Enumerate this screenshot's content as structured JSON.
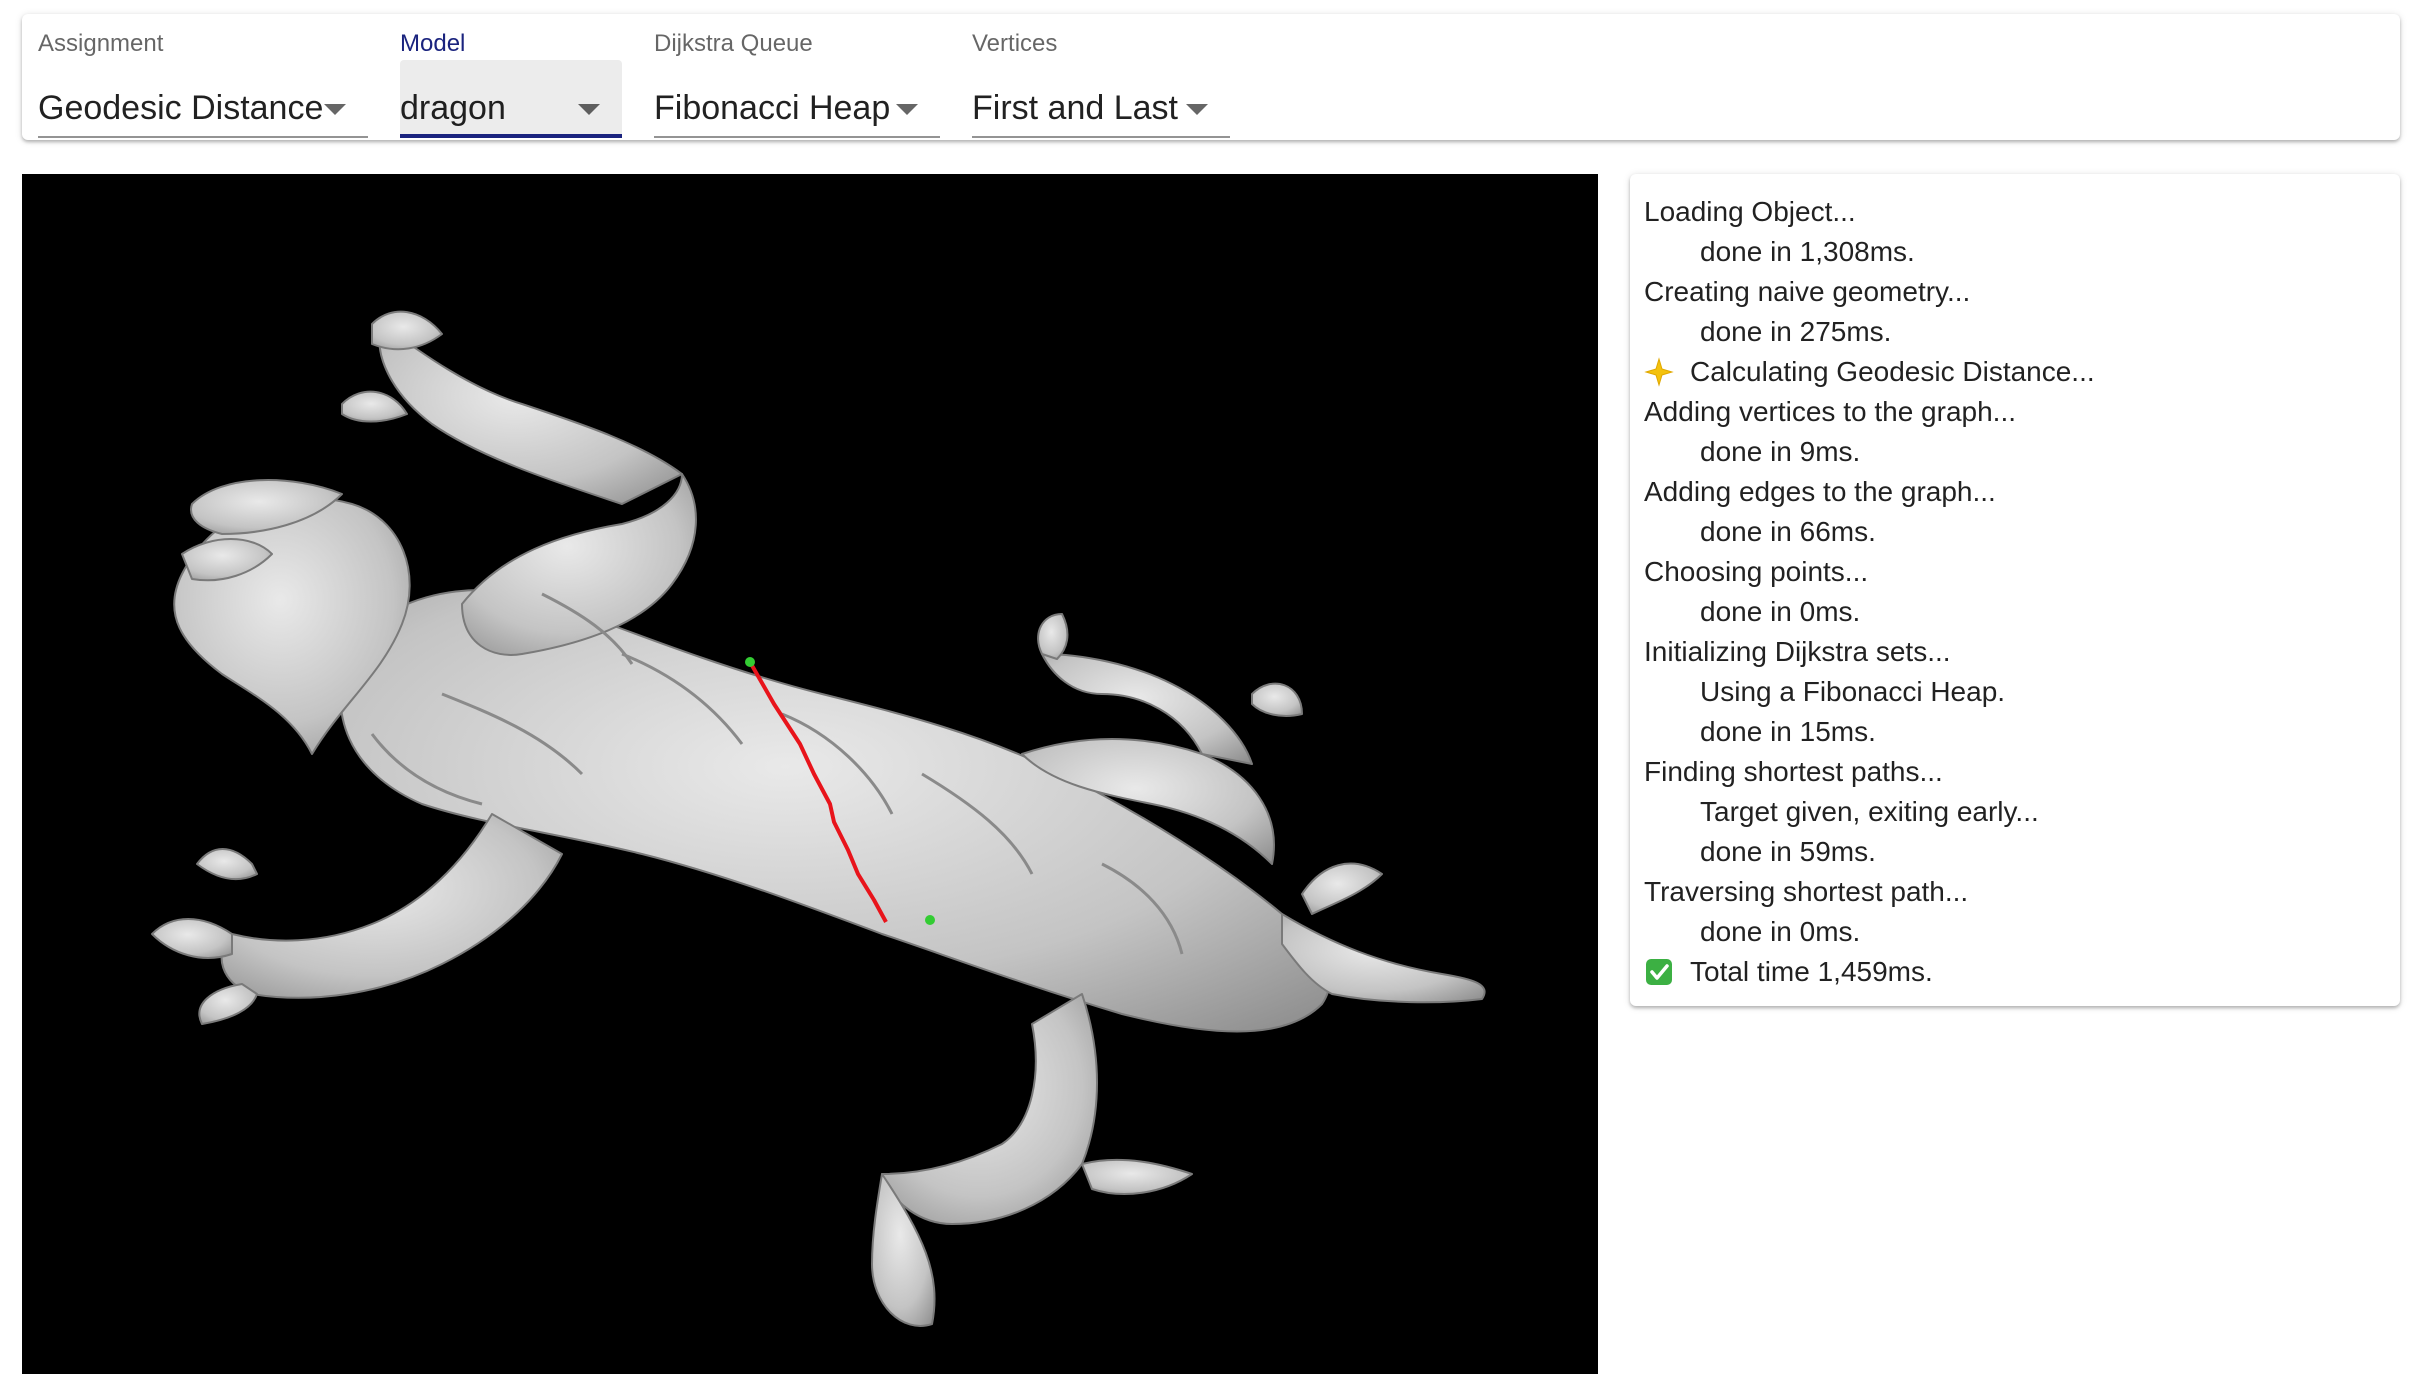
{
  "toolbar": {
    "assignment": {
      "label": "Assignment",
      "value": "Geodesic Distance"
    },
    "model": {
      "label": "Model",
      "value": "dragon"
    },
    "queue": {
      "label": "Dijkstra Queue",
      "value": "Fibonacci Heap"
    },
    "vertices": {
      "label": "Vertices",
      "value": "First and Last"
    }
  },
  "viewport": {
    "background": "#000000",
    "mesh_color": "#c4c4c4",
    "path_color": "#e8141b",
    "endpoint_color": "#33cc33"
  },
  "log": [
    {
      "text": "Loading Object...",
      "indent": false
    },
    {
      "text": "done in 1,308ms.",
      "indent": true
    },
    {
      "text": "Creating naive geometry...",
      "indent": false
    },
    {
      "text": "done in 275ms.",
      "indent": true
    },
    {
      "text": "Calculating Geodesic Distance...",
      "indent": false,
      "icon": "sparkle-icon"
    },
    {
      "text": "Adding vertices to the graph...",
      "indent": false
    },
    {
      "text": "done in 9ms.",
      "indent": true
    },
    {
      "text": "Adding edges to the graph...",
      "indent": false
    },
    {
      "text": "done in 66ms.",
      "indent": true
    },
    {
      "text": "Choosing points...",
      "indent": false
    },
    {
      "text": "done in 0ms.",
      "indent": true
    },
    {
      "text": "Initializing Dijkstra sets...",
      "indent": false
    },
    {
      "text": "Using a Fibonacci Heap.",
      "indent": true
    },
    {
      "text": "done in 15ms.",
      "indent": true
    },
    {
      "text": "Finding shortest paths...",
      "indent": false
    },
    {
      "text": "Target given, exiting early...",
      "indent": true
    },
    {
      "text": "done in 59ms.",
      "indent": true
    },
    {
      "text": "Traversing shortest path...",
      "indent": false
    },
    {
      "text": "done in 0ms.",
      "indent": true
    },
    {
      "text": "Total time 1,459ms.",
      "indent": false,
      "icon": "check-mark-icon"
    }
  ]
}
